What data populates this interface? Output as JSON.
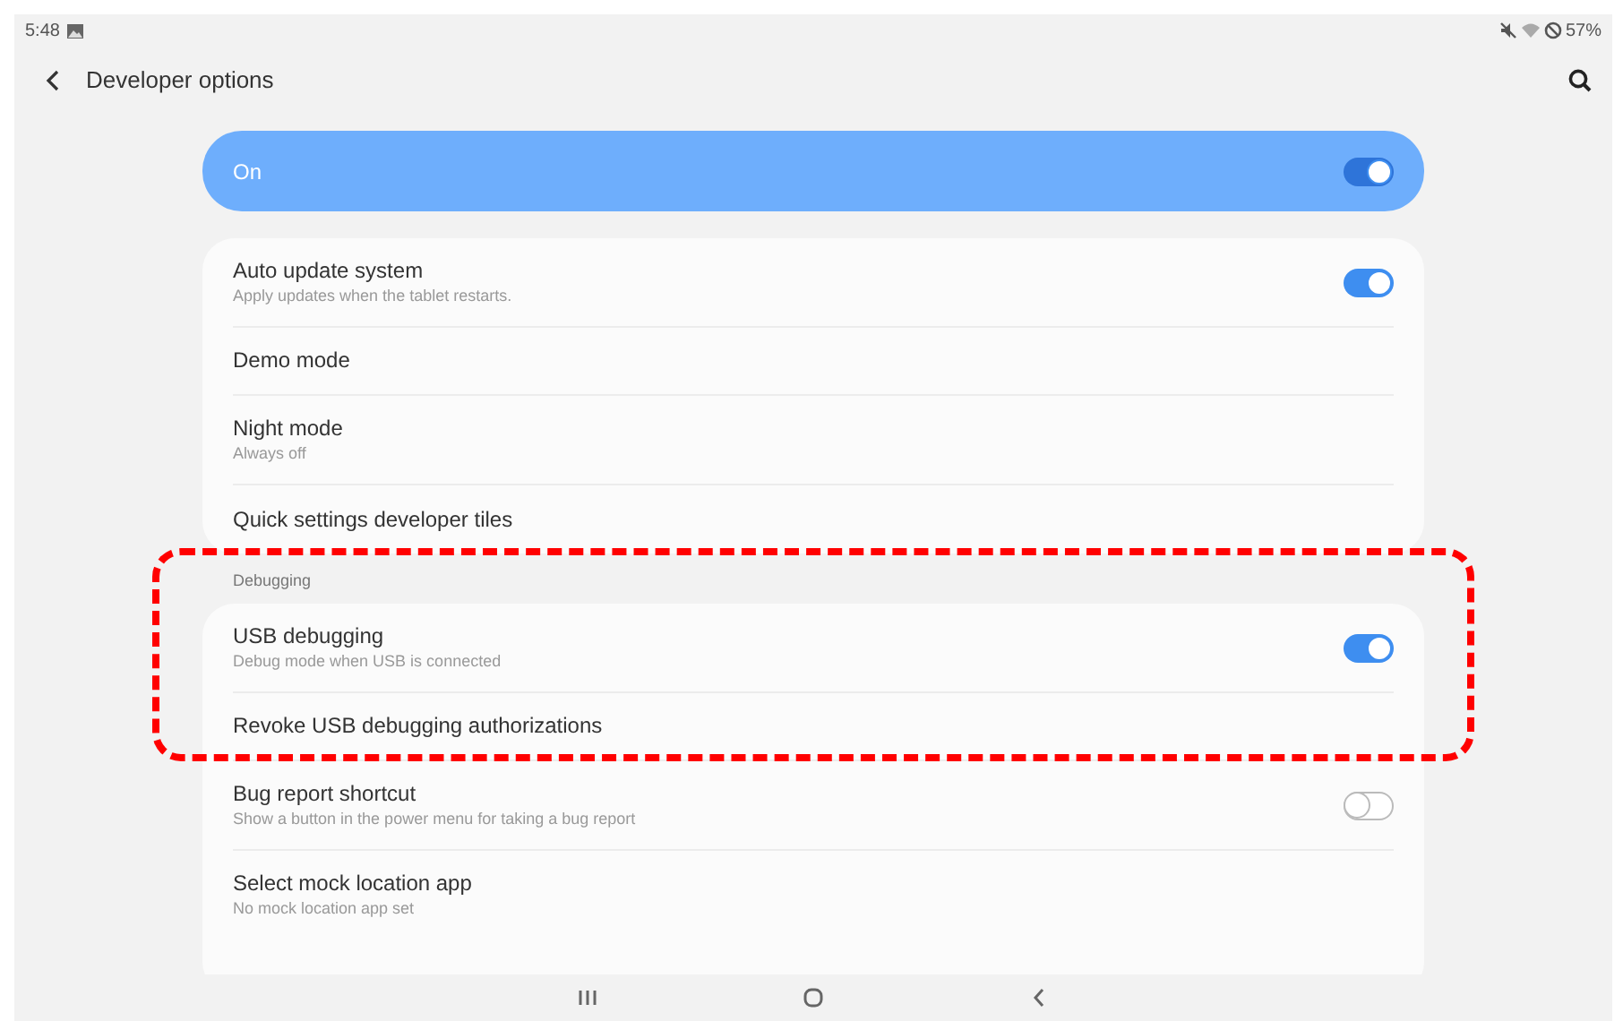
{
  "status_bar": {
    "time": "5:48",
    "battery": "57%"
  },
  "app_bar": {
    "title": "Developer options"
  },
  "master_switch": {
    "label": "On",
    "on": true
  },
  "sections": [
    {
      "items": [
        {
          "kind": "switch",
          "title": "Auto update system",
          "subtitle": "Apply updates when the tablet restarts.",
          "on": true
        },
        {
          "kind": "plain",
          "title": "Demo mode"
        },
        {
          "kind": "plain",
          "title": "Night mode",
          "subtitle": "Always off"
        },
        {
          "kind": "plain",
          "title": "Quick settings developer tiles"
        }
      ]
    },
    {
      "header": "Debugging",
      "highlighted": true,
      "items": [
        {
          "kind": "switch",
          "title": "USB debugging",
          "subtitle": "Debug mode when USB is connected",
          "on": true
        },
        {
          "kind": "plain",
          "title": "Revoke USB debugging authorizations",
          "highlighted": true
        },
        {
          "kind": "switch",
          "title": "Bug report shortcut",
          "subtitle": "Show a button in the power menu for taking a bug report",
          "on": false
        },
        {
          "kind": "plain",
          "title": "Select mock location app",
          "subtitle": "No mock location app set"
        }
      ]
    }
  ]
}
